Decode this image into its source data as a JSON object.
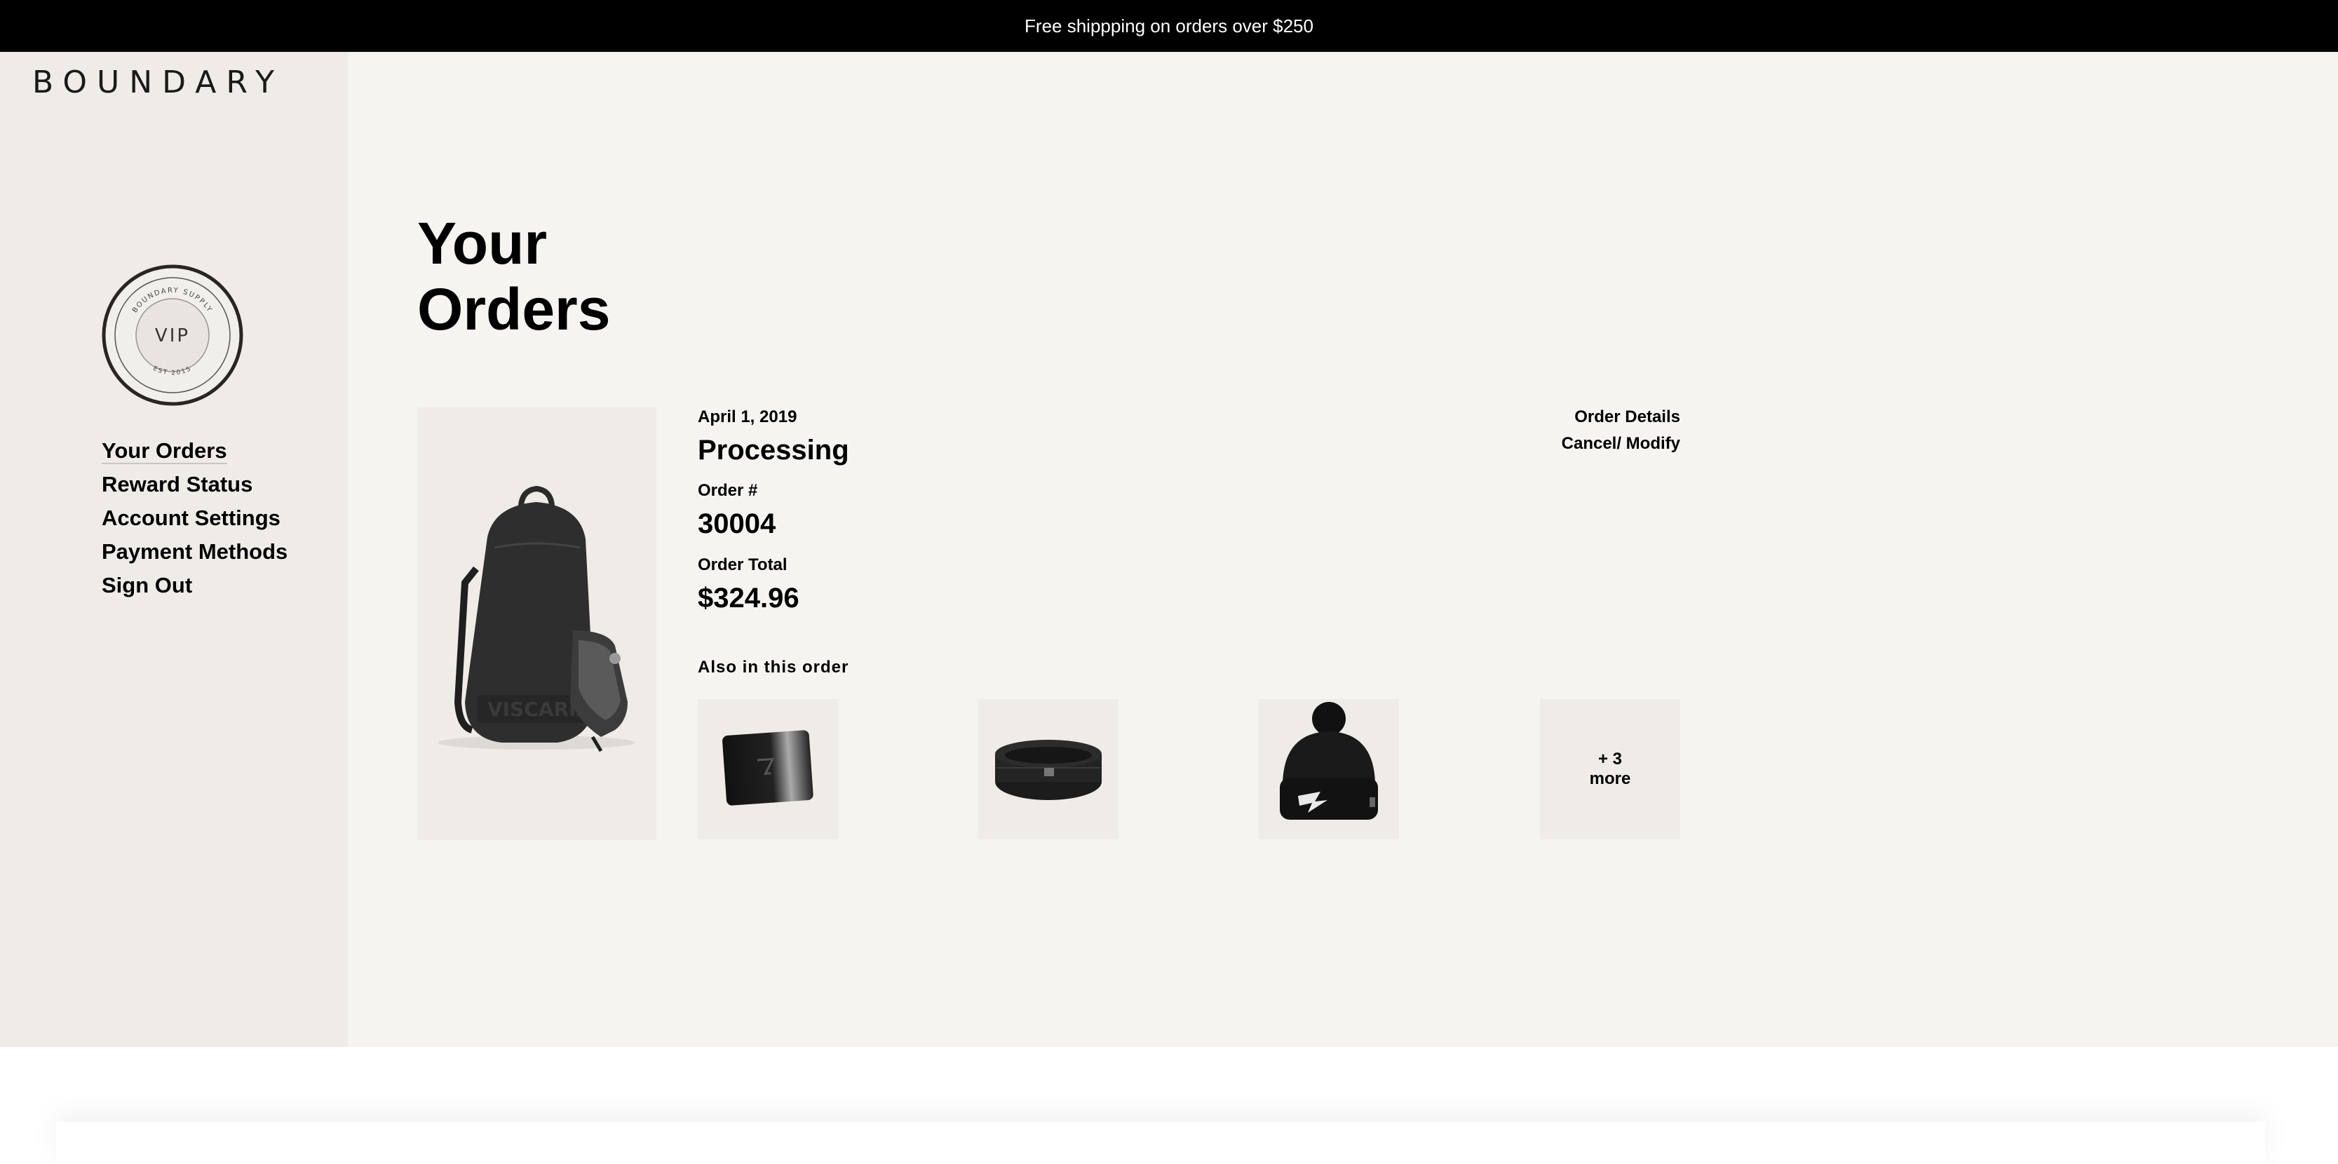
{
  "announcement": "Free shippping on orders over $250",
  "brand": {
    "logo": "BOUNDARY"
  },
  "vip_badge": {
    "center_text": "VIP",
    "ring_top": "BOUNDARY SUPPLY",
    "ring_bottom": "EST 2015"
  },
  "sidebar": {
    "nav": [
      {
        "label": "Your Orders",
        "active": true
      },
      {
        "label": "Reward Status"
      },
      {
        "label": "Account Settings"
      },
      {
        "label": "Payment Methods"
      },
      {
        "label": "Sign Out"
      }
    ]
  },
  "page": {
    "title": "Your Orders"
  },
  "order": {
    "date": "April 1, 2019",
    "status": "Processing",
    "number_label": "Order #",
    "number": "30004",
    "total_label": "Order Total",
    "total": "$324.96",
    "actions": {
      "details": "Order Details",
      "cancel_modify": "Cancel/ Modify"
    },
    "also_label": "Also in this order",
    "items": [
      {
        "icon": "gift-card-icon"
      },
      {
        "icon": "headband-icon"
      },
      {
        "icon": "beanie-icon"
      }
    ],
    "more_label": "+ 3 more"
  },
  "colors": {
    "sidebar_bg": "#efece8",
    "main_bg": "#f5f4f1",
    "topbar_bg": "#000000"
  }
}
